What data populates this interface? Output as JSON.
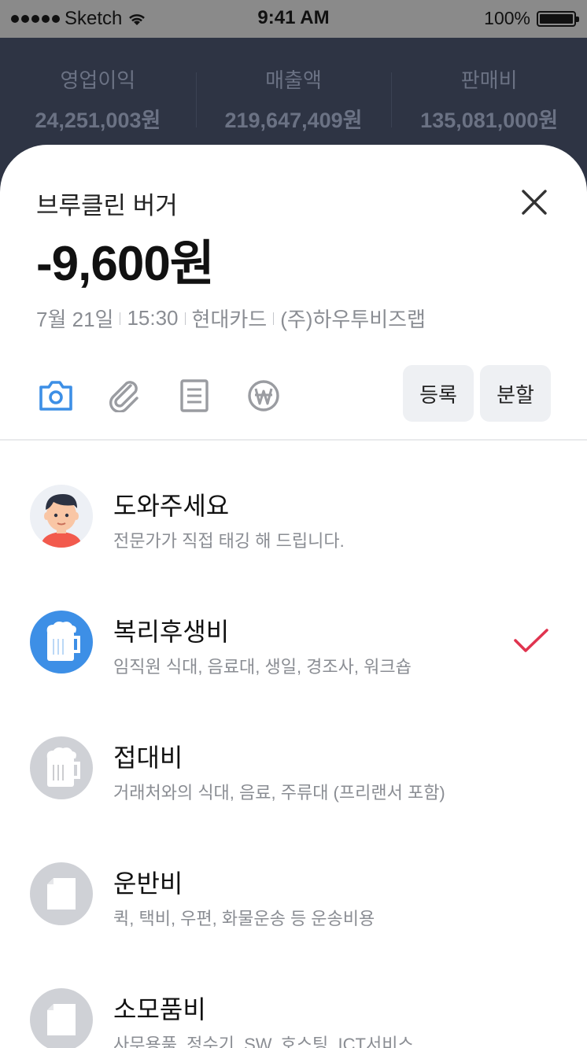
{
  "status_bar": {
    "carrier": "Sketch",
    "time": "9:41 AM",
    "battery": "100%"
  },
  "stats": [
    {
      "label": "영업이익",
      "value": "24,251,003원"
    },
    {
      "label": "매출액",
      "value": "219,647,409원"
    },
    {
      "label": "판매비",
      "value": "135,081,000원"
    }
  ],
  "transaction": {
    "merchant": "브루클린 버거",
    "amount": "-9,600원",
    "date": "7월 21일",
    "time": "15:30",
    "card": "현대카드",
    "company": "(주)하우투비즈랩"
  },
  "toolbar": {
    "icons": [
      "camera-icon",
      "paperclip-icon",
      "document-icon",
      "won-icon"
    ],
    "register_label": "등록",
    "split_label": "분할"
  },
  "categories": [
    {
      "title": "도와주세요",
      "desc": "전문가가 직접 태깅 해 드립니다.",
      "icon": "person-avatar",
      "selected": false
    },
    {
      "title": "복리후생비",
      "desc": "임직원 식대, 음료대, 생일, 경조사, 워크숍",
      "icon": "beer-icon",
      "selected": true
    },
    {
      "title": "접대비",
      "desc": "거래처와의 식대, 음료, 주류대 (프리랜서 포함)",
      "icon": "beer-icon",
      "selected": false
    },
    {
      "title": "운반비",
      "desc": "퀵, 택비, 우편, 화물운송 등 운송비용",
      "icon": "paper-icon",
      "selected": false
    },
    {
      "title": "소모품비",
      "desc": "사무용품, 정수기, SW, 호스팅, ICT서비스",
      "icon": "paper-icon",
      "selected": false
    }
  ],
  "colors": {
    "header_bg": "#2e3444",
    "accent_blue": "#3d8fe6",
    "check_red": "#e0344f",
    "inactive_icon_bg": "#cfd1d6"
  }
}
